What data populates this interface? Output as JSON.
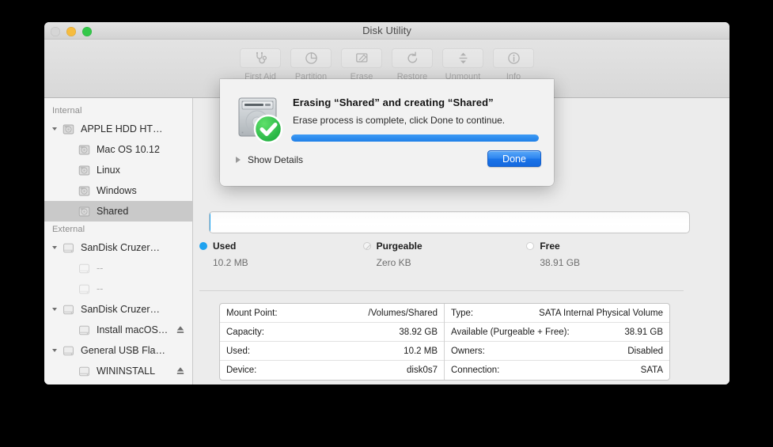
{
  "window": {
    "title": "Disk Utility",
    "traffic_lights": [
      "close",
      "minimize",
      "zoom"
    ]
  },
  "toolbar": {
    "buttons": [
      {
        "label": "First Aid",
        "icon": "stethoscope-icon",
        "enabled": false
      },
      {
        "label": "Partition",
        "icon": "pie-chart-icon",
        "enabled": false
      },
      {
        "label": "Erase",
        "icon": "erase-icon",
        "enabled": false
      },
      {
        "label": "Restore",
        "icon": "restore-arrow-icon",
        "enabled": false
      },
      {
        "label": "Unmount",
        "icon": "unmount-icon",
        "enabled": false
      },
      {
        "label": "Info",
        "icon": "info-circle-icon",
        "enabled": false
      }
    ]
  },
  "sidebar": {
    "sections": [
      {
        "header": "Internal",
        "rows": [
          {
            "label": "APPLE HDD HT…",
            "indent": 0,
            "icon": "internal-drive-icon",
            "disclosure": "open",
            "selected": false,
            "dim": false,
            "eject": false
          },
          {
            "label": "Mac OS 10.12",
            "indent": 1,
            "icon": "internal-drive-icon",
            "disclosure": "none",
            "selected": false,
            "dim": false,
            "eject": false
          },
          {
            "label": "Linux",
            "indent": 1,
            "icon": "internal-drive-icon",
            "disclosure": "none",
            "selected": false,
            "dim": false,
            "eject": false
          },
          {
            "label": "Windows",
            "indent": 1,
            "icon": "internal-drive-icon",
            "disclosure": "none",
            "selected": false,
            "dim": false,
            "eject": false
          },
          {
            "label": "Shared",
            "indent": 1,
            "icon": "internal-drive-icon",
            "disclosure": "none",
            "selected": true,
            "dim": false,
            "eject": false
          }
        ]
      },
      {
        "header": "External",
        "rows": [
          {
            "label": "SanDisk Cruzer…",
            "indent": 0,
            "icon": "external-drive-icon",
            "disclosure": "open",
            "selected": false,
            "dim": false,
            "eject": false
          },
          {
            "label": "--",
            "indent": 1,
            "icon": "external-drive-icon",
            "disclosure": "none",
            "selected": false,
            "dim": true,
            "eject": false
          },
          {
            "label": "--",
            "indent": 1,
            "icon": "external-drive-icon",
            "disclosure": "none",
            "selected": false,
            "dim": true,
            "eject": false
          },
          {
            "label": "SanDisk Cruzer…",
            "indent": 0,
            "icon": "external-drive-icon",
            "disclosure": "open",
            "selected": false,
            "dim": false,
            "eject": false
          },
          {
            "label": "Install macOS…",
            "indent": 1,
            "icon": "external-drive-icon",
            "disclosure": "none",
            "selected": false,
            "dim": false,
            "eject": true
          },
          {
            "label": "General USB Fla…",
            "indent": 0,
            "icon": "external-drive-icon",
            "disclosure": "open",
            "selected": false,
            "dim": false,
            "eject": false
          },
          {
            "label": "WININSTALL",
            "indent": 1,
            "icon": "external-drive-icon",
            "disclosure": "none",
            "selected": false,
            "dim": false,
            "eject": true
          }
        ]
      }
    ]
  },
  "main": {
    "capacity_bar": {
      "used_percent": 0.026
    },
    "legend": [
      {
        "name": "Used",
        "value": "10.2 MB",
        "swatch": "used"
      },
      {
        "name": "Purgeable",
        "value": "Zero KB",
        "swatch": "purge"
      },
      {
        "name": "Free",
        "value": "38.91 GB",
        "swatch": "free"
      }
    ],
    "info_left": [
      {
        "key": "Mount Point:",
        "value": "/Volumes/Shared"
      },
      {
        "key": "Capacity:",
        "value": "38.92 GB"
      },
      {
        "key": "Used:",
        "value": "10.2 MB"
      },
      {
        "key": "Device:",
        "value": "disk0s7"
      }
    ],
    "info_right": [
      {
        "key": "Type:",
        "value": "SATA Internal Physical Volume"
      },
      {
        "key": "Available (Purgeable + Free):",
        "value": "38.91 GB"
      },
      {
        "key": "Owners:",
        "value": "Disabled"
      },
      {
        "key": "Connection:",
        "value": "SATA"
      }
    ]
  },
  "dialog": {
    "icon": "hard-drive-success-icon",
    "title": "Erasing “Shared” and creating “Shared”",
    "message": "Erase process is complete, click Done to continue.",
    "progress_percent": 100,
    "show_details_label": "Show Details",
    "done_label": "Done",
    "accent_color": "#1f7fe8"
  }
}
